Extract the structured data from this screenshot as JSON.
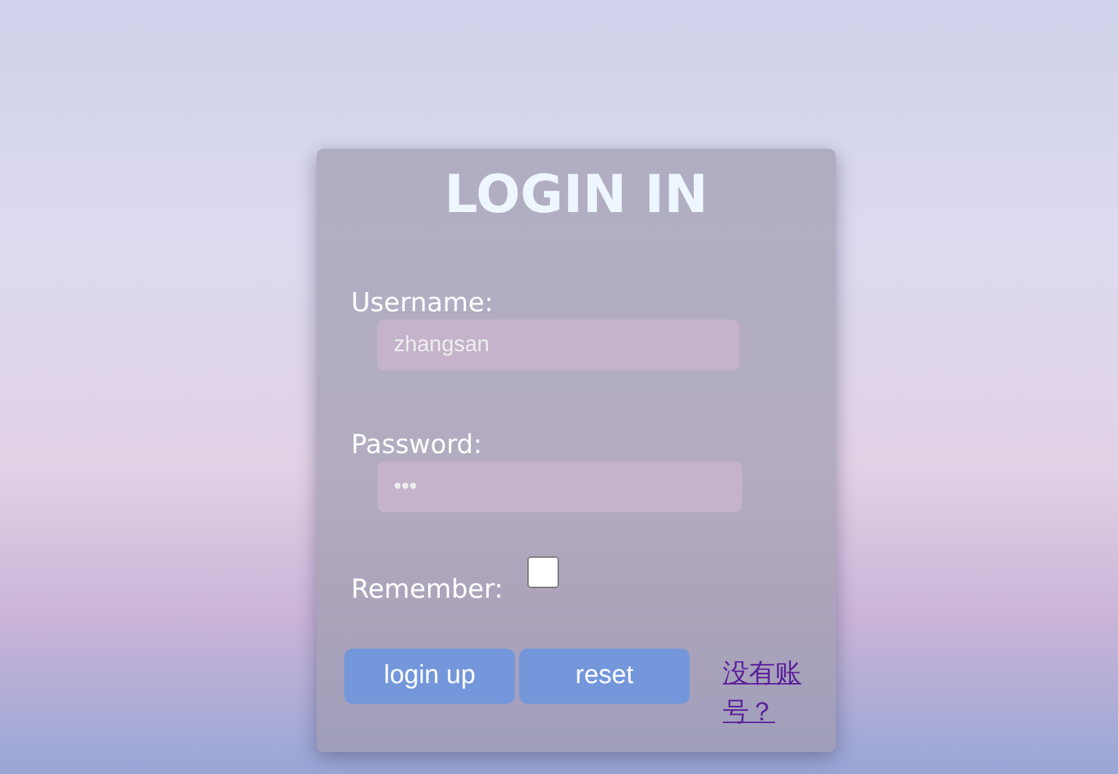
{
  "login_form": {
    "title": "LOGIN IN",
    "fields": [
      {
        "label": "Username:",
        "kind": "text",
        "value": "zhangsan"
      },
      {
        "label": "Password:",
        "kind": "password",
        "value": "•••"
      }
    ],
    "remember": {
      "label": "Remember:",
      "checked": false
    },
    "buttons": [
      "login up",
      "reset"
    ],
    "signup_link": "没有账号？"
  }
}
